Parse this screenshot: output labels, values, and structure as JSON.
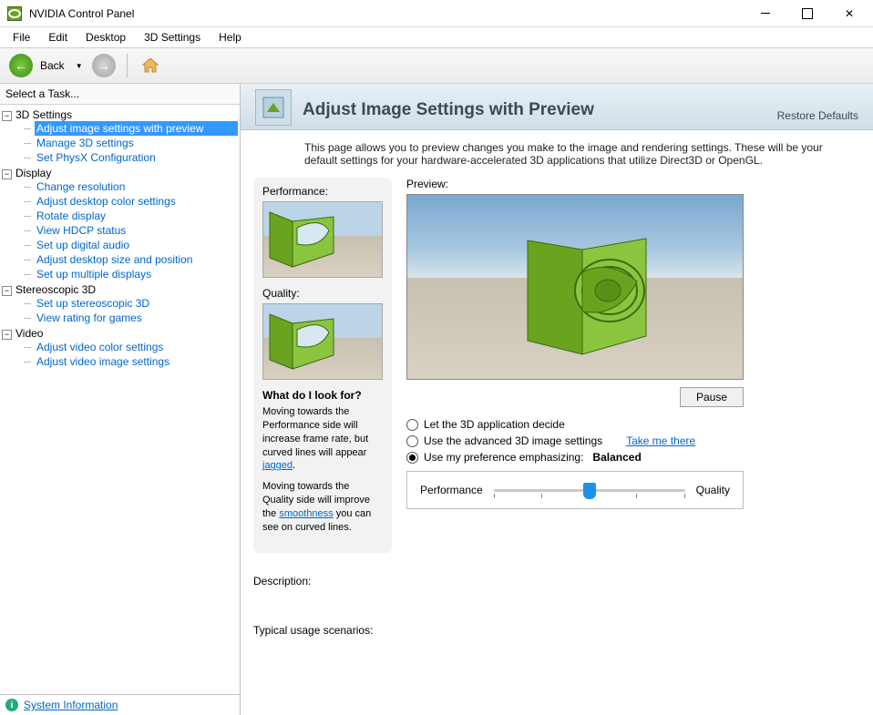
{
  "window": {
    "title": "NVIDIA Control Panel"
  },
  "menu": {
    "file": "File",
    "edit": "Edit",
    "desktop": "Desktop",
    "settings3d": "3D Settings",
    "help": "Help"
  },
  "toolbar": {
    "back": "Back"
  },
  "sidebar": {
    "header": "Select a Task...",
    "groups": {
      "g3d": {
        "label": "3D Settings",
        "items": [
          "Adjust image settings with preview",
          "Manage 3D settings",
          "Set PhysX Configuration"
        ]
      },
      "display": {
        "label": "Display",
        "items": [
          "Change resolution",
          "Adjust desktop color settings",
          "Rotate display",
          "View HDCP status",
          "Set up digital audio",
          "Adjust desktop size and position",
          "Set up multiple displays"
        ]
      },
      "stereo": {
        "label": "Stereoscopic 3D",
        "items": [
          "Set up stereoscopic 3D",
          "View rating for games"
        ]
      },
      "video": {
        "label": "Video",
        "items": [
          "Adjust video color settings",
          "Adjust video image settings"
        ]
      }
    },
    "footer": "System Information"
  },
  "page": {
    "title": "Adjust Image Settings with Preview",
    "restore": "Restore Defaults",
    "intro": "This page allows you to preview changes you make to the image and rendering settings. These will be your default settings for your hardware-accelerated 3D applications that utilize Direct3D or OpenGL.",
    "perf_label": "Performance:",
    "quality_label": "Quality:",
    "preview_label": "Preview:",
    "look_for": "What do I look for?",
    "perf_text_a": "Moving towards the Performance side will increase frame rate, but curved lines will appear ",
    "perf_text_link": "jagged",
    "perf_text_b": ".",
    "quality_text_a": "Moving towards the Quality side will improve the ",
    "quality_text_link": "smoothness",
    "quality_text_b": " you can see on curved lines.",
    "pause": "Pause",
    "radio1": "Let the 3D application decide",
    "radio2": "Use the advanced 3D image settings",
    "take_me": "Take me there",
    "radio3": "Use my preference emphasizing:",
    "balanced": "Balanced",
    "slider_left": "Performance",
    "slider_right": "Quality",
    "description": "Description:",
    "typical": "Typical usage scenarios:"
  }
}
